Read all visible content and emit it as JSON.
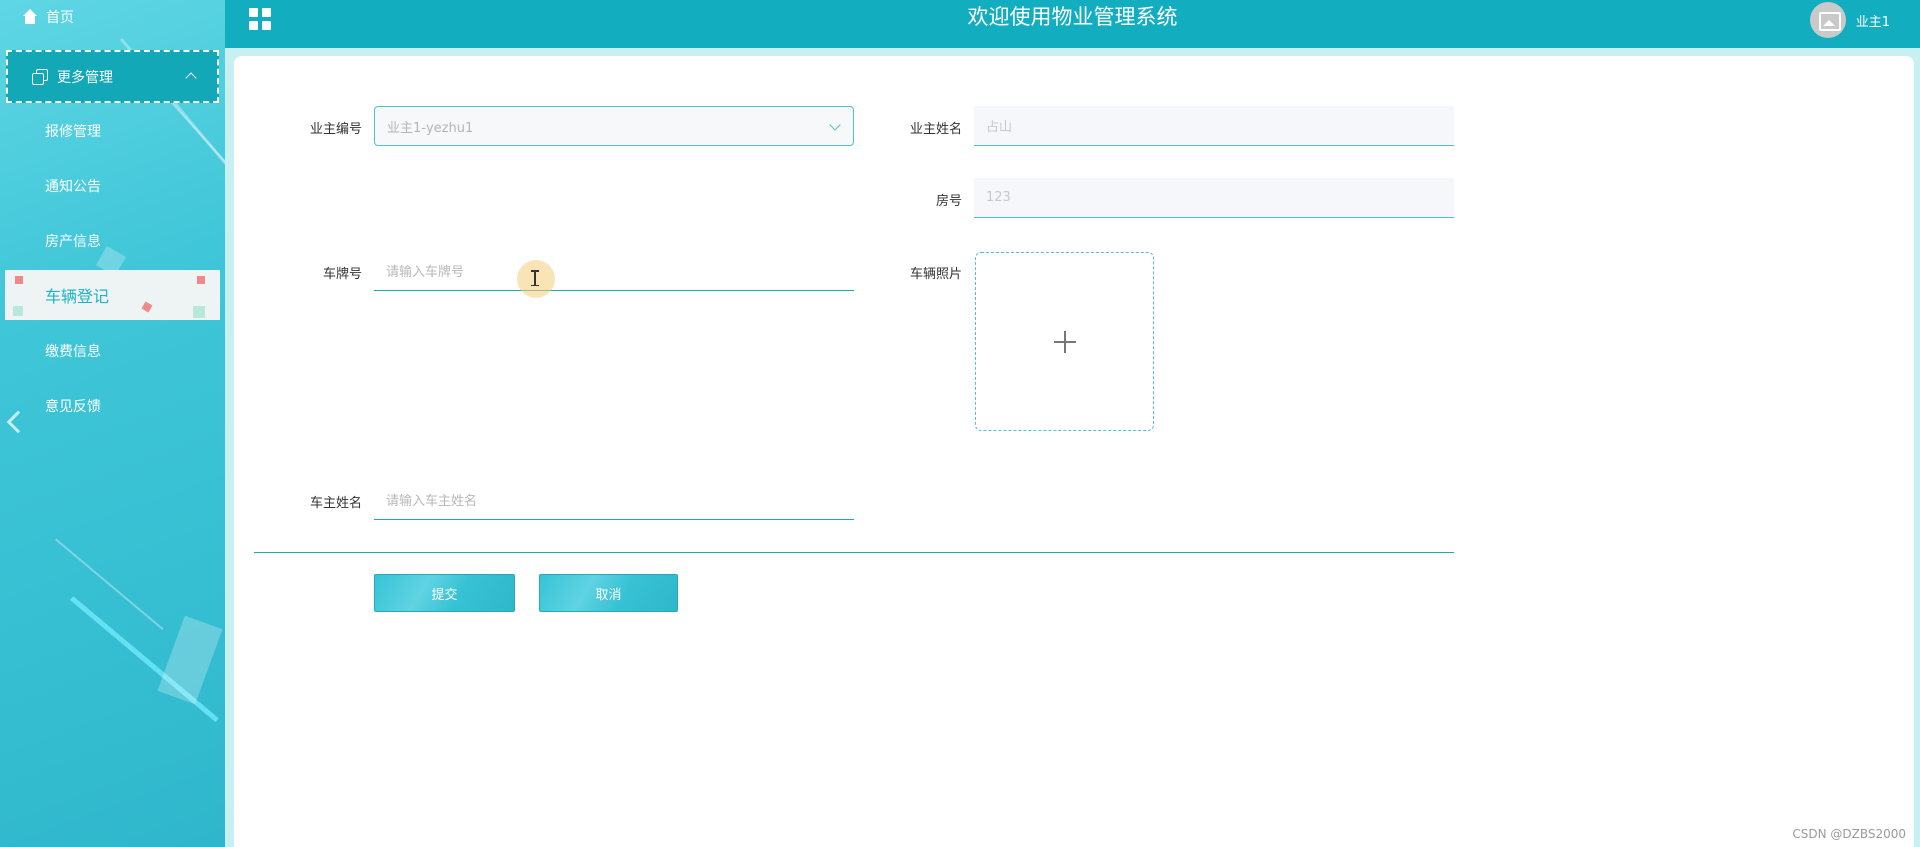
{
  "header": {
    "title": "欢迎使用物业管理系统",
    "user_name": "业主1"
  },
  "sidebar": {
    "home_label": "首页",
    "group_label": "更多管理",
    "items": [
      {
        "label": "报修管理"
      },
      {
        "label": "通知公告"
      },
      {
        "label": "房产信息"
      },
      {
        "label": "车辆登记"
      },
      {
        "label": "缴费信息"
      },
      {
        "label": "意见反馈"
      }
    ],
    "active_item": "车辆登记"
  },
  "form": {
    "owner_id": {
      "label": "业主编号",
      "value": "业主1-yezhu1"
    },
    "owner_name": {
      "label": "业主姓名",
      "value": "占山"
    },
    "room_no": {
      "label": "房号",
      "value": "123"
    },
    "plate_no": {
      "label": "车牌号",
      "placeholder": "请输入车牌号"
    },
    "vehicle_photo": {
      "label": "车辆照片"
    },
    "car_owner_name": {
      "label": "车主姓名",
      "placeholder": "请输入车主姓名"
    },
    "submit_label": "提交",
    "cancel_label": "取消"
  },
  "watermark": "CSDN @DZBS2000",
  "colors": {
    "accent": "#12aebf",
    "sidebar": "#3fc6d8",
    "active_text": "#1fb3c6"
  }
}
